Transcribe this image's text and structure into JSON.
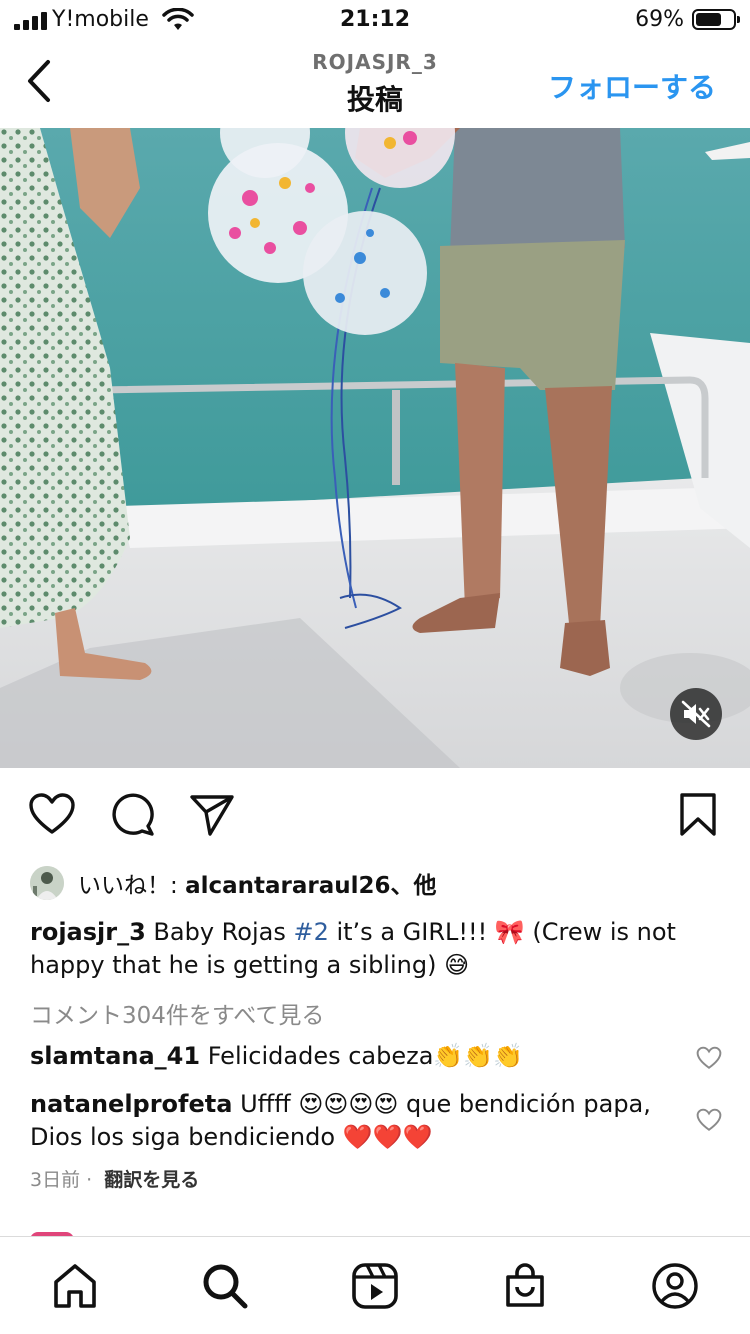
{
  "status_bar": {
    "carrier": "Y!mobile",
    "time": "21:12",
    "battery_percent": "69%",
    "battery_level": 0.69
  },
  "header": {
    "username": "ROJASJR_3",
    "title": "投稿",
    "follow_label": "フォローする"
  },
  "media": {
    "type": "video",
    "muted": true
  },
  "likes": {
    "prefix": "いいね！: ",
    "user": "alcantararaul26",
    "suffix": "、他"
  },
  "caption": {
    "username": "rojasjr_3",
    "text_before": " Baby Rojas ",
    "hashtag": "#2",
    "text_after": " it’s a GIRL!!! 🎀 (Crew is not happy that he is getting a sibling) 😅"
  },
  "view_all_comments": "コメント304件をすべて見る",
  "comments": [
    {
      "username": "slamtana_41",
      "text": " Felicidades cabeza👏👏👏"
    },
    {
      "username": "natanelprofeta",
      "text": " Uffff 😍😍😍😍 que bendición papa, Dios los siga bendiciendo ❤️❤️❤️"
    }
  ],
  "meta": {
    "age": "3日前",
    "separator": " · ",
    "translate_label": "翻訳を見る"
  },
  "icons": {
    "like": "heart-icon",
    "comment": "comment-icon",
    "share": "send-icon",
    "save": "bookmark-icon",
    "mute": "speaker-muted-icon"
  },
  "colors": {
    "accent": "#2a95f0",
    "hashtag": "#2f5e9e",
    "secondary_text": "#8a8a8a"
  }
}
